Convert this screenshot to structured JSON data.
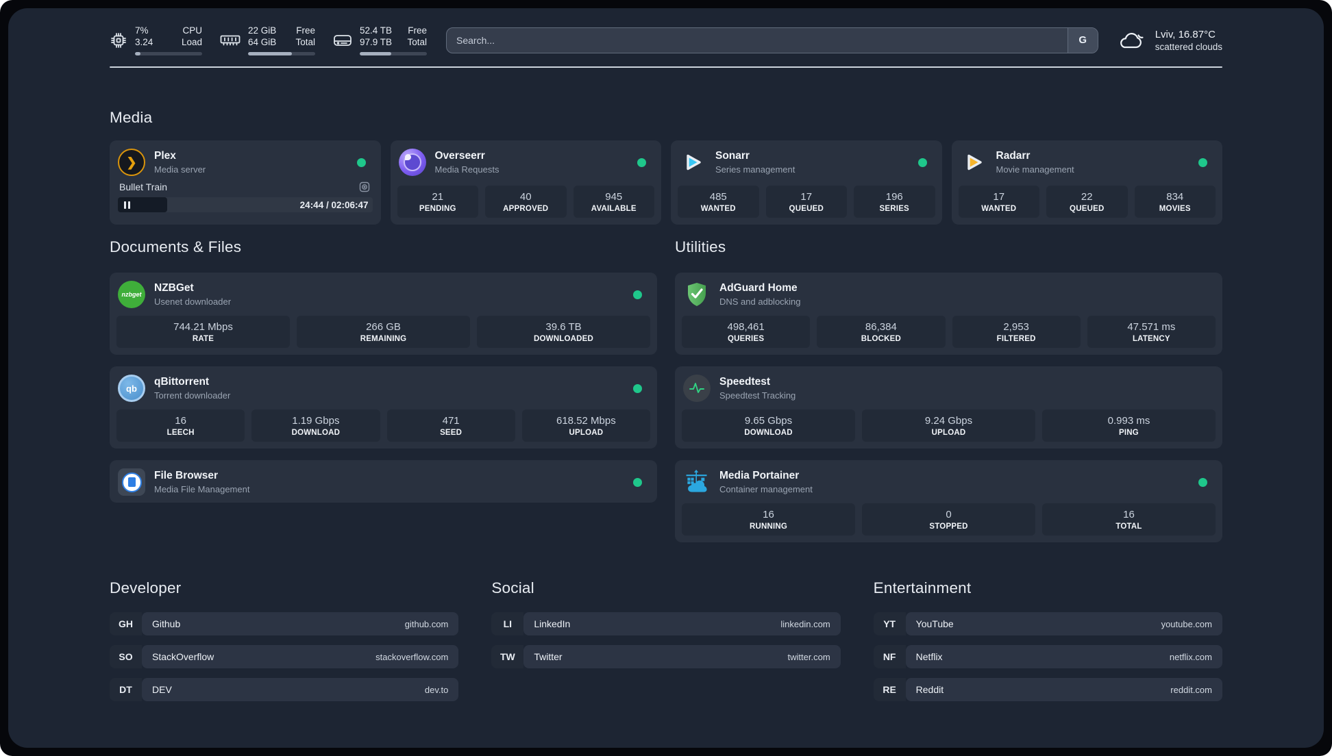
{
  "header": {
    "cpu": {
      "line1": "7%",
      "line2": "3.24",
      "label1": "CPU",
      "label2": "Load",
      "progress": 8
    },
    "memory": {
      "line1": "22 GiB",
      "line2": "64 GiB",
      "label1": "Free",
      "label2": "Total",
      "progress": 65
    },
    "disk": {
      "line1": "52.4 TB",
      "line2": "97.9 TB",
      "label1": "Free",
      "label2": "Total",
      "progress": 47
    },
    "search": {
      "placeholder": "Search...",
      "engine": "G"
    },
    "weather": {
      "location": "Lviv, 16.87°C",
      "condition": "scattered clouds"
    }
  },
  "colors": {
    "accent_green": "#1fc78b",
    "panel_bg": "#1d2533",
    "card_bg": "#29313f"
  },
  "icons": {
    "plex_glyph": "❯",
    "nzbget_text": "nzbget",
    "qb_text": "qb"
  },
  "sections": {
    "media": {
      "title": "Media",
      "plex": {
        "name": "Plex",
        "description": "Media server",
        "now_playing": "Bullet Train",
        "time_display": "24:44 / 02:06:47",
        "progress_pct": 19.5
      },
      "overseerr": {
        "name": "Overseerr",
        "description": "Media Requests",
        "stats": [
          {
            "value": "21",
            "label": "PENDING"
          },
          {
            "value": "40",
            "label": "APPROVED"
          },
          {
            "value": "945",
            "label": "AVAILABLE"
          }
        ]
      },
      "sonarr": {
        "name": "Sonarr",
        "description": "Series management",
        "stats": [
          {
            "value": "485",
            "label": "WANTED"
          },
          {
            "value": "17",
            "label": "QUEUED"
          },
          {
            "value": "196",
            "label": "SERIES"
          }
        ]
      },
      "radarr": {
        "name": "Radarr",
        "description": "Movie management",
        "stats": [
          {
            "value": "17",
            "label": "WANTED"
          },
          {
            "value": "22",
            "label": "QUEUED"
          },
          {
            "value": "834",
            "label": "MOVIES"
          }
        ]
      }
    },
    "documents": {
      "title": "Documents & Files",
      "nzbget": {
        "name": "NZBGet",
        "description": "Usenet downloader",
        "stats": [
          {
            "value": "744.21 Mbps",
            "label": "RATE"
          },
          {
            "value": "266 GB",
            "label": "REMAINING"
          },
          {
            "value": "39.6 TB",
            "label": "DOWNLOADED"
          }
        ]
      },
      "qbittorrent": {
        "name": "qBittorrent",
        "description": "Torrent downloader",
        "stats": [
          {
            "value": "16",
            "label": "LEECH"
          },
          {
            "value": "1.19 Gbps",
            "label": "DOWNLOAD"
          },
          {
            "value": "471",
            "label": "SEED"
          },
          {
            "value": "618.52 Mbps",
            "label": "UPLOAD"
          }
        ]
      },
      "filebrowser": {
        "name": "File Browser",
        "description": "Media File Management"
      }
    },
    "utilities": {
      "title": "Utilities",
      "adguard": {
        "name": "AdGuard Home",
        "description": "DNS and adblocking",
        "stats": [
          {
            "value": "498,461",
            "label": "QUERIES"
          },
          {
            "value": "86,384",
            "label": "BLOCKED"
          },
          {
            "value": "2,953",
            "label": "FILTERED"
          },
          {
            "value": "47.571 ms",
            "label": "LATENCY"
          }
        ]
      },
      "speedtest": {
        "name": "Speedtest",
        "description": "Speedtest Tracking",
        "stats": [
          {
            "value": "9.65 Gbps",
            "label": "DOWNLOAD"
          },
          {
            "value": "9.24 Gbps",
            "label": "UPLOAD"
          },
          {
            "value": "0.993 ms",
            "label": "PING"
          }
        ]
      },
      "portainer": {
        "name": "Media Portainer",
        "description": "Container management",
        "stats": [
          {
            "value": "16",
            "label": "RUNNING"
          },
          {
            "value": "0",
            "label": "STOPPED"
          },
          {
            "value": "16",
            "label": "TOTAL"
          }
        ]
      }
    },
    "developer": {
      "title": "Developer",
      "links": [
        {
          "abbr": "GH",
          "name": "Github",
          "url": "github.com"
        },
        {
          "abbr": "SO",
          "name": "StackOverflow",
          "url": "stackoverflow.com"
        },
        {
          "abbr": "DT",
          "name": "DEV",
          "url": "dev.to"
        }
      ]
    },
    "social": {
      "title": "Social",
      "links": [
        {
          "abbr": "LI",
          "name": "LinkedIn",
          "url": "linkedin.com"
        },
        {
          "abbr": "TW",
          "name": "Twitter",
          "url": "twitter.com"
        }
      ]
    },
    "entertainment": {
      "title": "Entertainment",
      "links": [
        {
          "abbr": "YT",
          "name": "YouTube",
          "url": "youtube.com"
        },
        {
          "abbr": "NF",
          "name": "Netflix",
          "url": "netflix.com"
        },
        {
          "abbr": "RE",
          "name": "Reddit",
          "url": "reddit.com"
        }
      ]
    }
  }
}
